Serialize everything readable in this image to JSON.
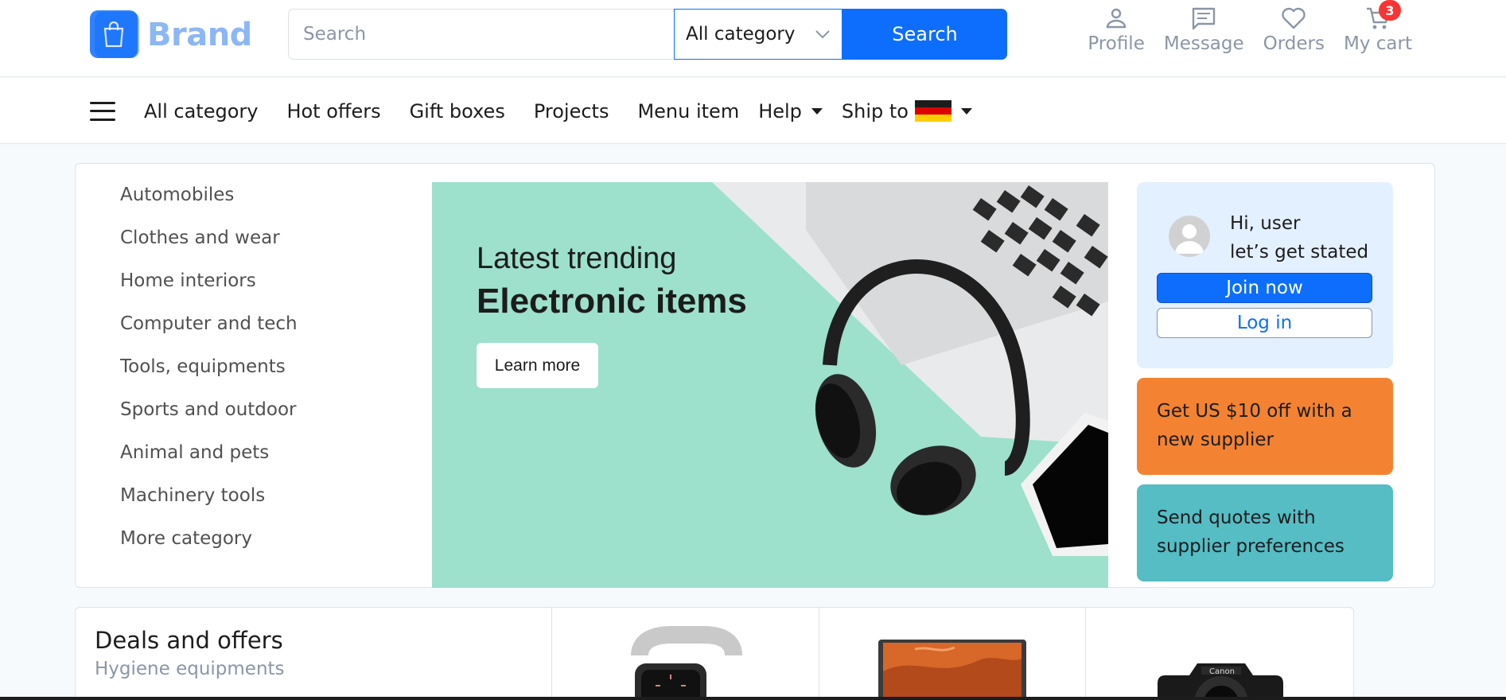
{
  "brand": {
    "name": "Brand"
  },
  "search": {
    "placeholder": "Search",
    "category": "All category",
    "button": "Search"
  },
  "header_actions": [
    {
      "label": "Profile",
      "icon": "user-icon"
    },
    {
      "label": "Message",
      "icon": "message-icon"
    },
    {
      "label": "Orders",
      "icon": "heart-icon"
    },
    {
      "label": "My cart",
      "icon": "cart-icon",
      "badge": "3"
    }
  ],
  "nav": {
    "items": [
      "All category",
      "Hot offers",
      "Gift boxes",
      "Projects",
      "Menu item",
      "Help",
      "Ship to"
    ]
  },
  "categories": [
    "Automobiles",
    "Clothes and wear",
    "Home interiors",
    "Computer and tech",
    "Tools, equipments",
    "Sports and outdoor",
    "Animal and pets",
    "Machinery tools",
    "More category"
  ],
  "banner": {
    "line1": "Latest trending",
    "line2": "Electronic items",
    "button": "Learn more"
  },
  "user_card": {
    "greeting1": "Hi, user",
    "greeting2": "let’s get stated",
    "join": "Join now",
    "login": "Log in"
  },
  "promos": {
    "orange": "Get US $10 off with a new supplier",
    "teal": "Send quotes with supplier preferences"
  },
  "deals": {
    "title": "Deals and offers",
    "subtitle": "Hygiene equipments"
  },
  "colors": {
    "accent": "#0d6efd",
    "orange": "#f38332",
    "teal": "#55bdc3",
    "banner_bg": "#9de0cb",
    "badge": "#fa3434"
  }
}
